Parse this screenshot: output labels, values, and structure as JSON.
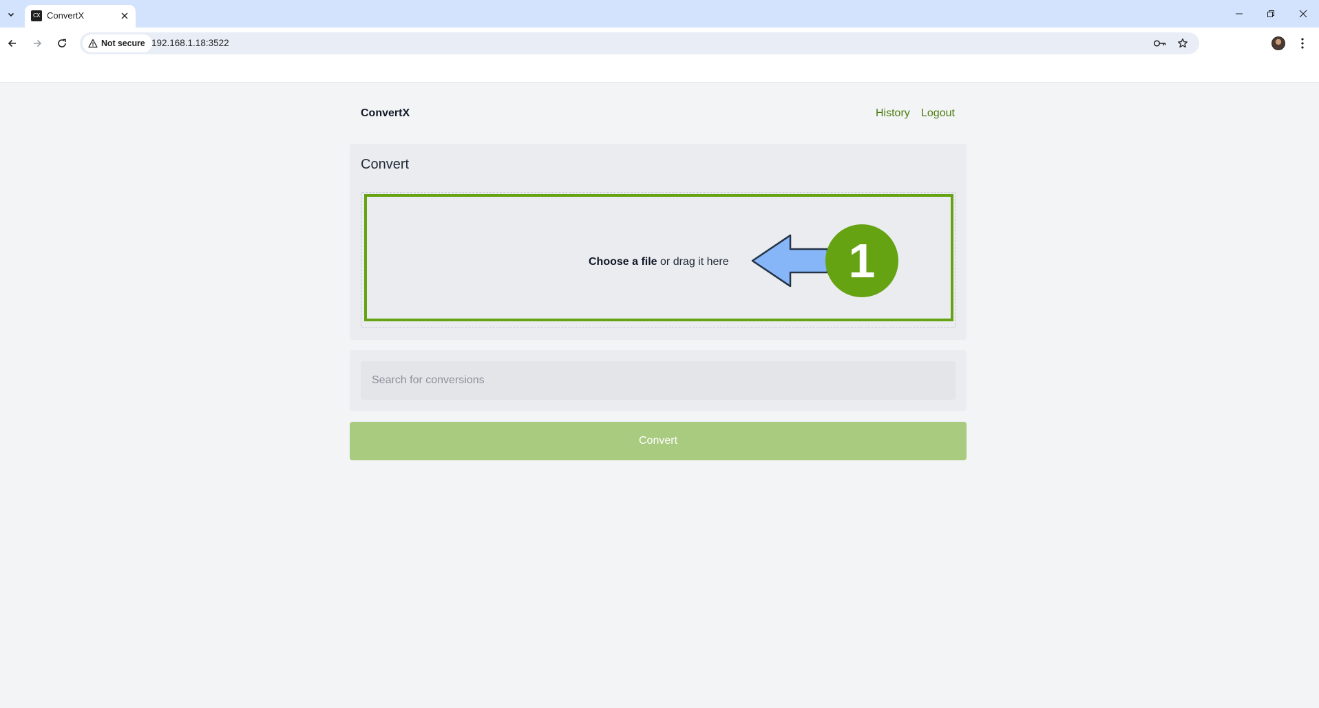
{
  "browser": {
    "tab_title": "ConvertX",
    "tab_favicon_text": "CX",
    "security_label": "Not secure",
    "url": "192.168.1.18:3522"
  },
  "header": {
    "brand": "ConvertX",
    "nav": [
      {
        "label": "History"
      },
      {
        "label": "Logout"
      }
    ]
  },
  "convert_card": {
    "title": "Convert",
    "dropzone": {
      "choose_label": "Choose a file",
      "drag_label": " or drag it here"
    }
  },
  "callout": {
    "step_number": "1",
    "colors": {
      "badge": "#66a313",
      "arrow": "#86b6f8",
      "highlight": "#66a313"
    }
  },
  "search": {
    "placeholder": "Search for conversions",
    "value": ""
  },
  "convert_button": {
    "label": "Convert",
    "color": "#a9cb80"
  },
  "icons": [
    "tab-list-icon",
    "close-icon",
    "minimize-icon",
    "restore-icon",
    "back-icon",
    "forward-icon",
    "reload-icon",
    "warning-icon",
    "password-key-icon",
    "star-icon",
    "profile-avatar",
    "kebab-menu-icon",
    "left-arrow-icon"
  ]
}
